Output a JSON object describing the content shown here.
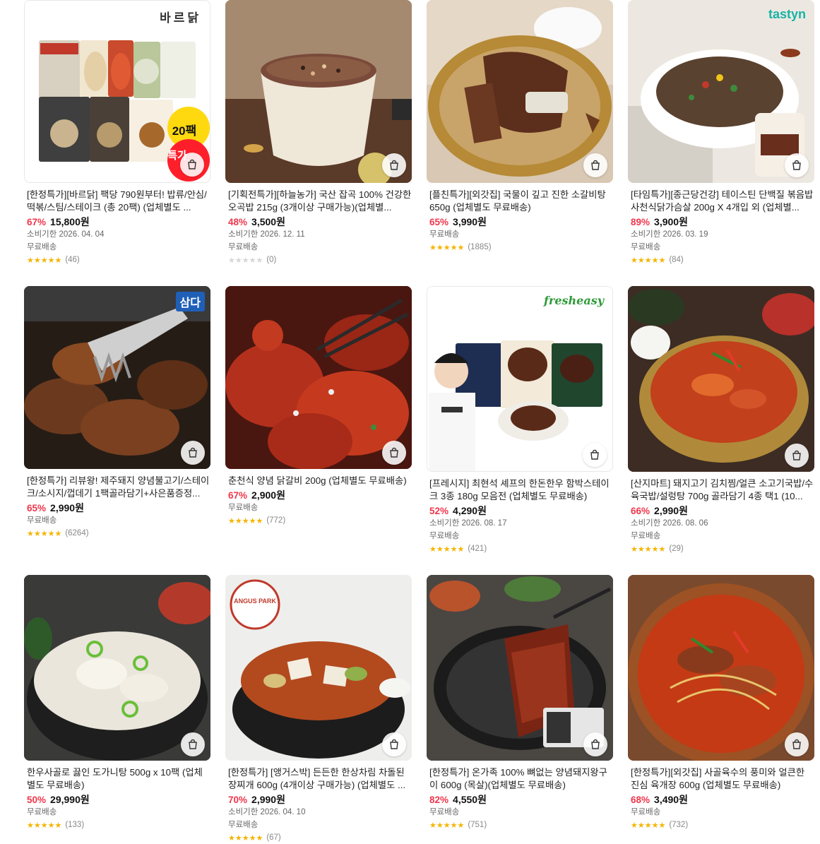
{
  "cart_icon": "shopping-bag-icon",
  "colors": {
    "discount": "#f0364c",
    "star": "#f4b400",
    "star_empty": "#d6d6d6"
  },
  "products": [
    {
      "brand_logo": "바르닭",
      "badge": "20팩",
      "badge2": "특가",
      "title": "[한정특가][바르닭] 팩당 790원부터! 밥류/안심/떡볶/스팀/스테이크 (총 20팩) (업체별도 ...",
      "discount": "67%",
      "price": "15,800원",
      "expiry": "소비기한 2026. 04. 04",
      "shipping": "무료배송",
      "stars": "★★★★★",
      "rating_count": "(46)"
    },
    {
      "title": "[기획전특가][하늘농가] 국산 잡곡 100% 건강한 오곡밥 215g (3개이상 구매가능)(업체별...",
      "discount": "48%",
      "price": "3,500원",
      "expiry": "소비기한 2026. 12. 11",
      "shipping": "무료배송",
      "stars": "★★★★★",
      "rating_count": "(0)"
    },
    {
      "title": "[플친특가][외갓집] 국물이 깊고 진한 소갈비탕 650g (업체별도 무료배송)",
      "discount": "65%",
      "price": "3,990원",
      "shipping": "무료배송",
      "stars": "★★★★★",
      "rating_count": "(1885)"
    },
    {
      "brand_logo": "tastyn",
      "title": "[타임특가][종근당건강] 테이스틴 단백질 볶음밥 사천식닭가슴살 200g X 4개입 외 (업체별...",
      "discount": "89%",
      "price": "3,900원",
      "expiry": "소비기한 2026. 03. 19",
      "shipping": "무료배송",
      "stars": "★★★★★",
      "rating_count": "(84)"
    },
    {
      "brand_logo": "삼다",
      "title": "[한정특가] 리뷰왕! 제주돼지 양념불고기/스테이크/소시지/껍데기 1팩골라담기+사은품증정...",
      "discount": "65%",
      "price": "2,990원",
      "shipping": "무료배송",
      "stars": "★★★★★",
      "rating_count": "(6264)"
    },
    {
      "title": "춘천식 양념 닭갈비 200g (업체별도 무료배송)",
      "discount": "67%",
      "price": "2,900원",
      "shipping": "무료배송",
      "stars": "★★★★★",
      "rating_count": "(772)"
    },
    {
      "brand_logo": "fresheasy",
      "title": "[프레시지] 최현석 셰프의 한돈한우 함박스테이크 3종 180g 모음전 (업체별도 무료배송)",
      "discount": "52%",
      "price": "4,290원",
      "expiry": "소비기한 2026. 08. 17",
      "shipping": "무료배송",
      "stars": "★★★★★",
      "rating_count": "(421)"
    },
    {
      "title": "[산지마트] 돼지고기 김치찜/얼큰 소고기국밥/수육국밥/설렁탕 700g 골라담기 4종 택1 (10...",
      "discount": "66%",
      "price": "2,990원",
      "expiry": "소비기한 2026. 08. 06",
      "shipping": "무료배송",
      "stars": "★★★★★",
      "rating_count": "(29)"
    },
    {
      "title": "한우사골로 끓인 도가니탕 500g x 10팩 (업체별도 무료배송)",
      "discount": "50%",
      "price": "29,990원",
      "shipping": "무료배송",
      "stars": "★★★★★",
      "rating_count": "(133)"
    },
    {
      "brand_logo": "ANGUS PARK",
      "title": "[한정특가] [앵거스박] 든든한 한상차림 차돌된장찌개 600g (4개이상 구매가능) (업체별도 ...",
      "discount": "70%",
      "price": "2,990원",
      "expiry": "소비기한 2026. 04. 10",
      "shipping": "무료배송",
      "stars": "★★★★★",
      "rating_count": "(67)"
    },
    {
      "title": "[한정특가] 온가족 100% 뼈없는 양념돼지왕구이 600g (목살)(업체별도 무료배송)",
      "discount": "82%",
      "price": "4,550원",
      "shipping": "무료배송",
      "stars": "★★★★★",
      "rating_count": "(751)"
    },
    {
      "title": "[한정특가][외갓집] 사골육수의 풍미와 얼큰한 진심 육개장 600g (업체별도 무료배송)",
      "discount": "68%",
      "price": "3,490원",
      "shipping": "무료배송",
      "stars": "★★★★★",
      "rating_count": "(732)"
    }
  ]
}
